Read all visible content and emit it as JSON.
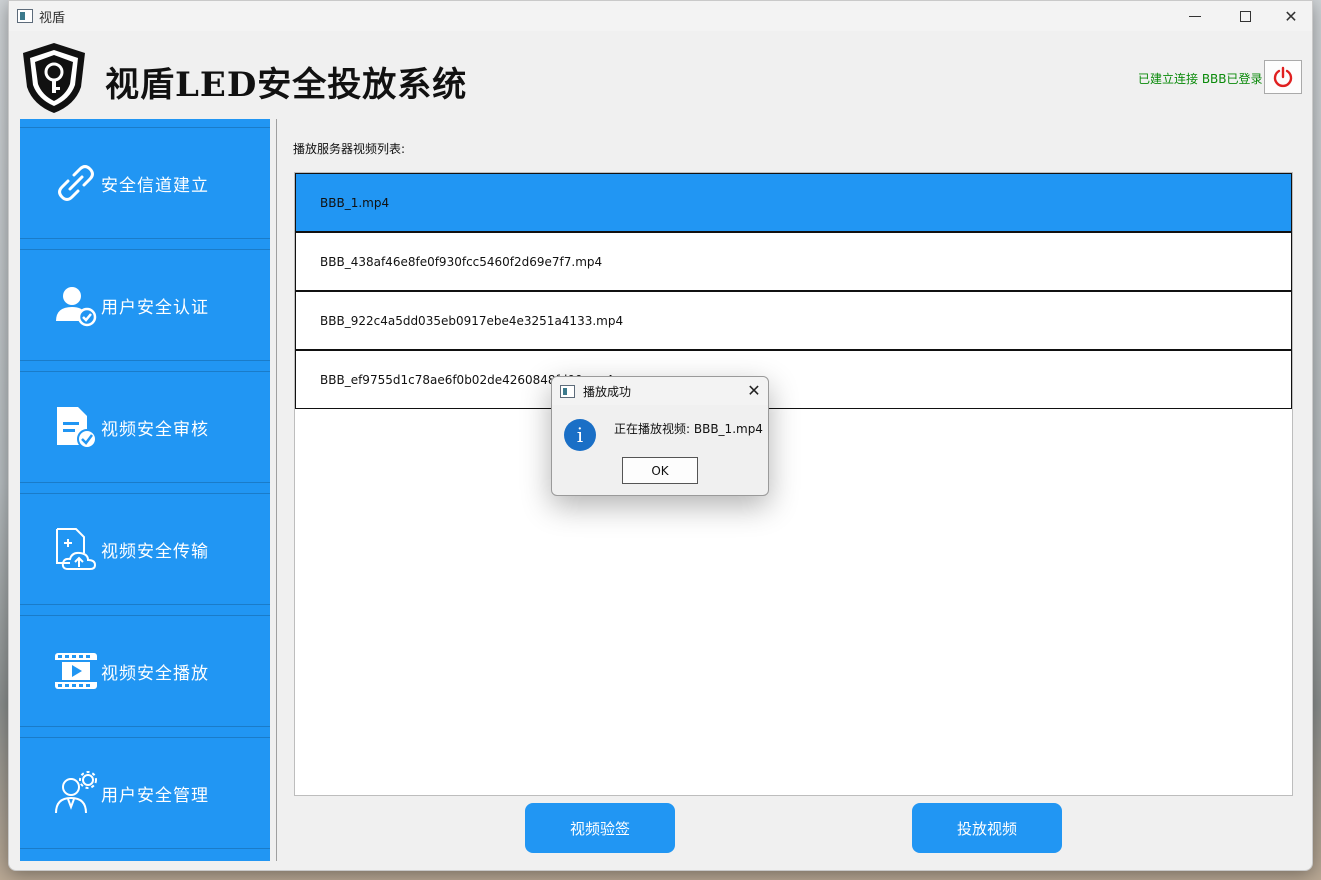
{
  "window": {
    "title": "视盾"
  },
  "header": {
    "app_title": "视盾LED安全投放系统",
    "status": "已建立连接 BBB已登录"
  },
  "sidebar": {
    "items": [
      {
        "label": "安全信道建立",
        "icon": "link-icon"
      },
      {
        "label": "用户安全认证",
        "icon": "user-check-icon"
      },
      {
        "label": "视频安全审核",
        "icon": "document-check-icon"
      },
      {
        "label": "视频安全传输",
        "icon": "cloud-upload-icon"
      },
      {
        "label": "视频安全播放",
        "icon": "video-play-icon"
      },
      {
        "label": "用户安全管理",
        "icon": "user-gear-icon"
      }
    ]
  },
  "main": {
    "list_caption": "播放服务器视频列表:",
    "videos": [
      "BBB_1.mp4",
      "BBB_438af46e8fe0f930fcc5460f2d69e7f7.mp4",
      "BBB_922c4a5dd035eb0917ebe4e3251a4133.mp4",
      "BBB_ef9755d1c78ae6f0b02de4260848fd00.mp4"
    ],
    "selected_index": 0,
    "verify_button": "视频验签",
    "cast_button": "投放视频"
  },
  "dialog": {
    "title": "播放成功",
    "message": "正在播放视频: BBB_1.mp4",
    "ok_label": "OK"
  },
  "colors": {
    "accent": "#2196f3",
    "status_green": "#0a8a0a",
    "power_red": "#e02020"
  }
}
